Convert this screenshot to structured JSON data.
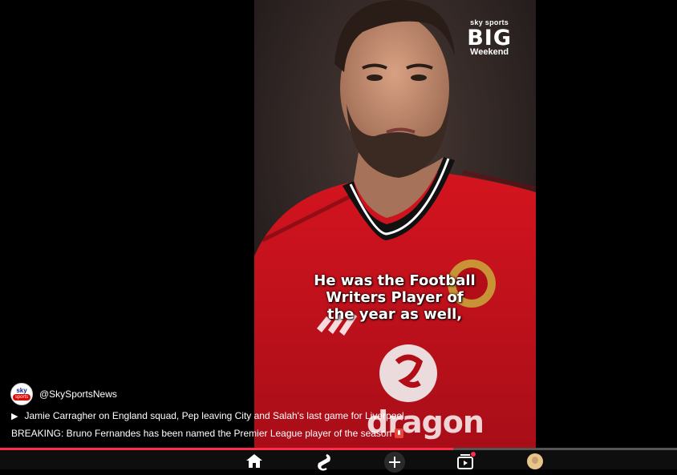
{
  "video": {
    "brand": {
      "top": "sky sports",
      "main": "BIG",
      "sub": "Weekend"
    },
    "caption": "He was the Football\nWriters Player of\nthe year as well,",
    "sponsor_text": "dragon"
  },
  "channel": {
    "handle": "@SkySportsNews",
    "avatar_top": "sky",
    "avatar_bottom": "sports"
  },
  "title": "Jamie Carragher on England squad, Pep leaving City and Salah's last game for Liverpool",
  "description": "BREAKING: Bruno Fernandes has been named the Premier League player of the season",
  "progress": {
    "fraction": 0.67
  },
  "colors": {
    "progress_fill": "#ff2d4a",
    "shirt": "#c8102e",
    "background": "#000000"
  },
  "nav": [
    "home-icon",
    "shorts-icon",
    "create-icon",
    "subscriptions-icon",
    "you-avatar"
  ]
}
